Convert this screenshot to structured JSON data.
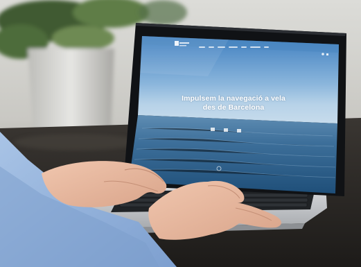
{
  "website": {
    "hero_line_1": "Impulsem la navegació a vela",
    "hero_line_2": "des de Barcelona",
    "nav_item_count": 7
  },
  "colors": {
    "sky_top": "#3f7fc0",
    "sky_horizon": "#b7d2e8",
    "sea_dark": "#1f4f79",
    "laptop_silver": "#c9ccd0",
    "bezel": "#101215",
    "sleeve": "#8eb0dc",
    "skin": "#e6b7a0",
    "plant_green": "#4e6c3a",
    "pot_grey": "#d4d4d2",
    "table": "#2a2724"
  }
}
